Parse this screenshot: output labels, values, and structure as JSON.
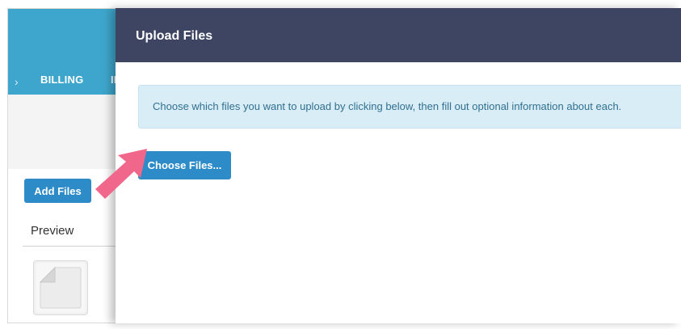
{
  "background_page": {
    "tabs": [
      {
        "label": "BILLING"
      },
      {
        "label": "IN"
      }
    ],
    "add_files_label": "Add Files",
    "preview_label": "Preview"
  },
  "modal": {
    "title": "Upload Files",
    "info_text": "Choose which files you want to upload by clicking below, then fill out optional information about each.",
    "choose_files_label": "Choose Files..."
  },
  "colors": {
    "header_blue": "#3ea6cc",
    "modal_header": "#3d4562",
    "button_blue": "#2d8cc8",
    "info_bg": "#d9edf7",
    "arrow_pink": "#f0678b"
  },
  "icons": {
    "file_thumbnail": "file-icon",
    "pointer_arrow": "arrow-icon"
  }
}
